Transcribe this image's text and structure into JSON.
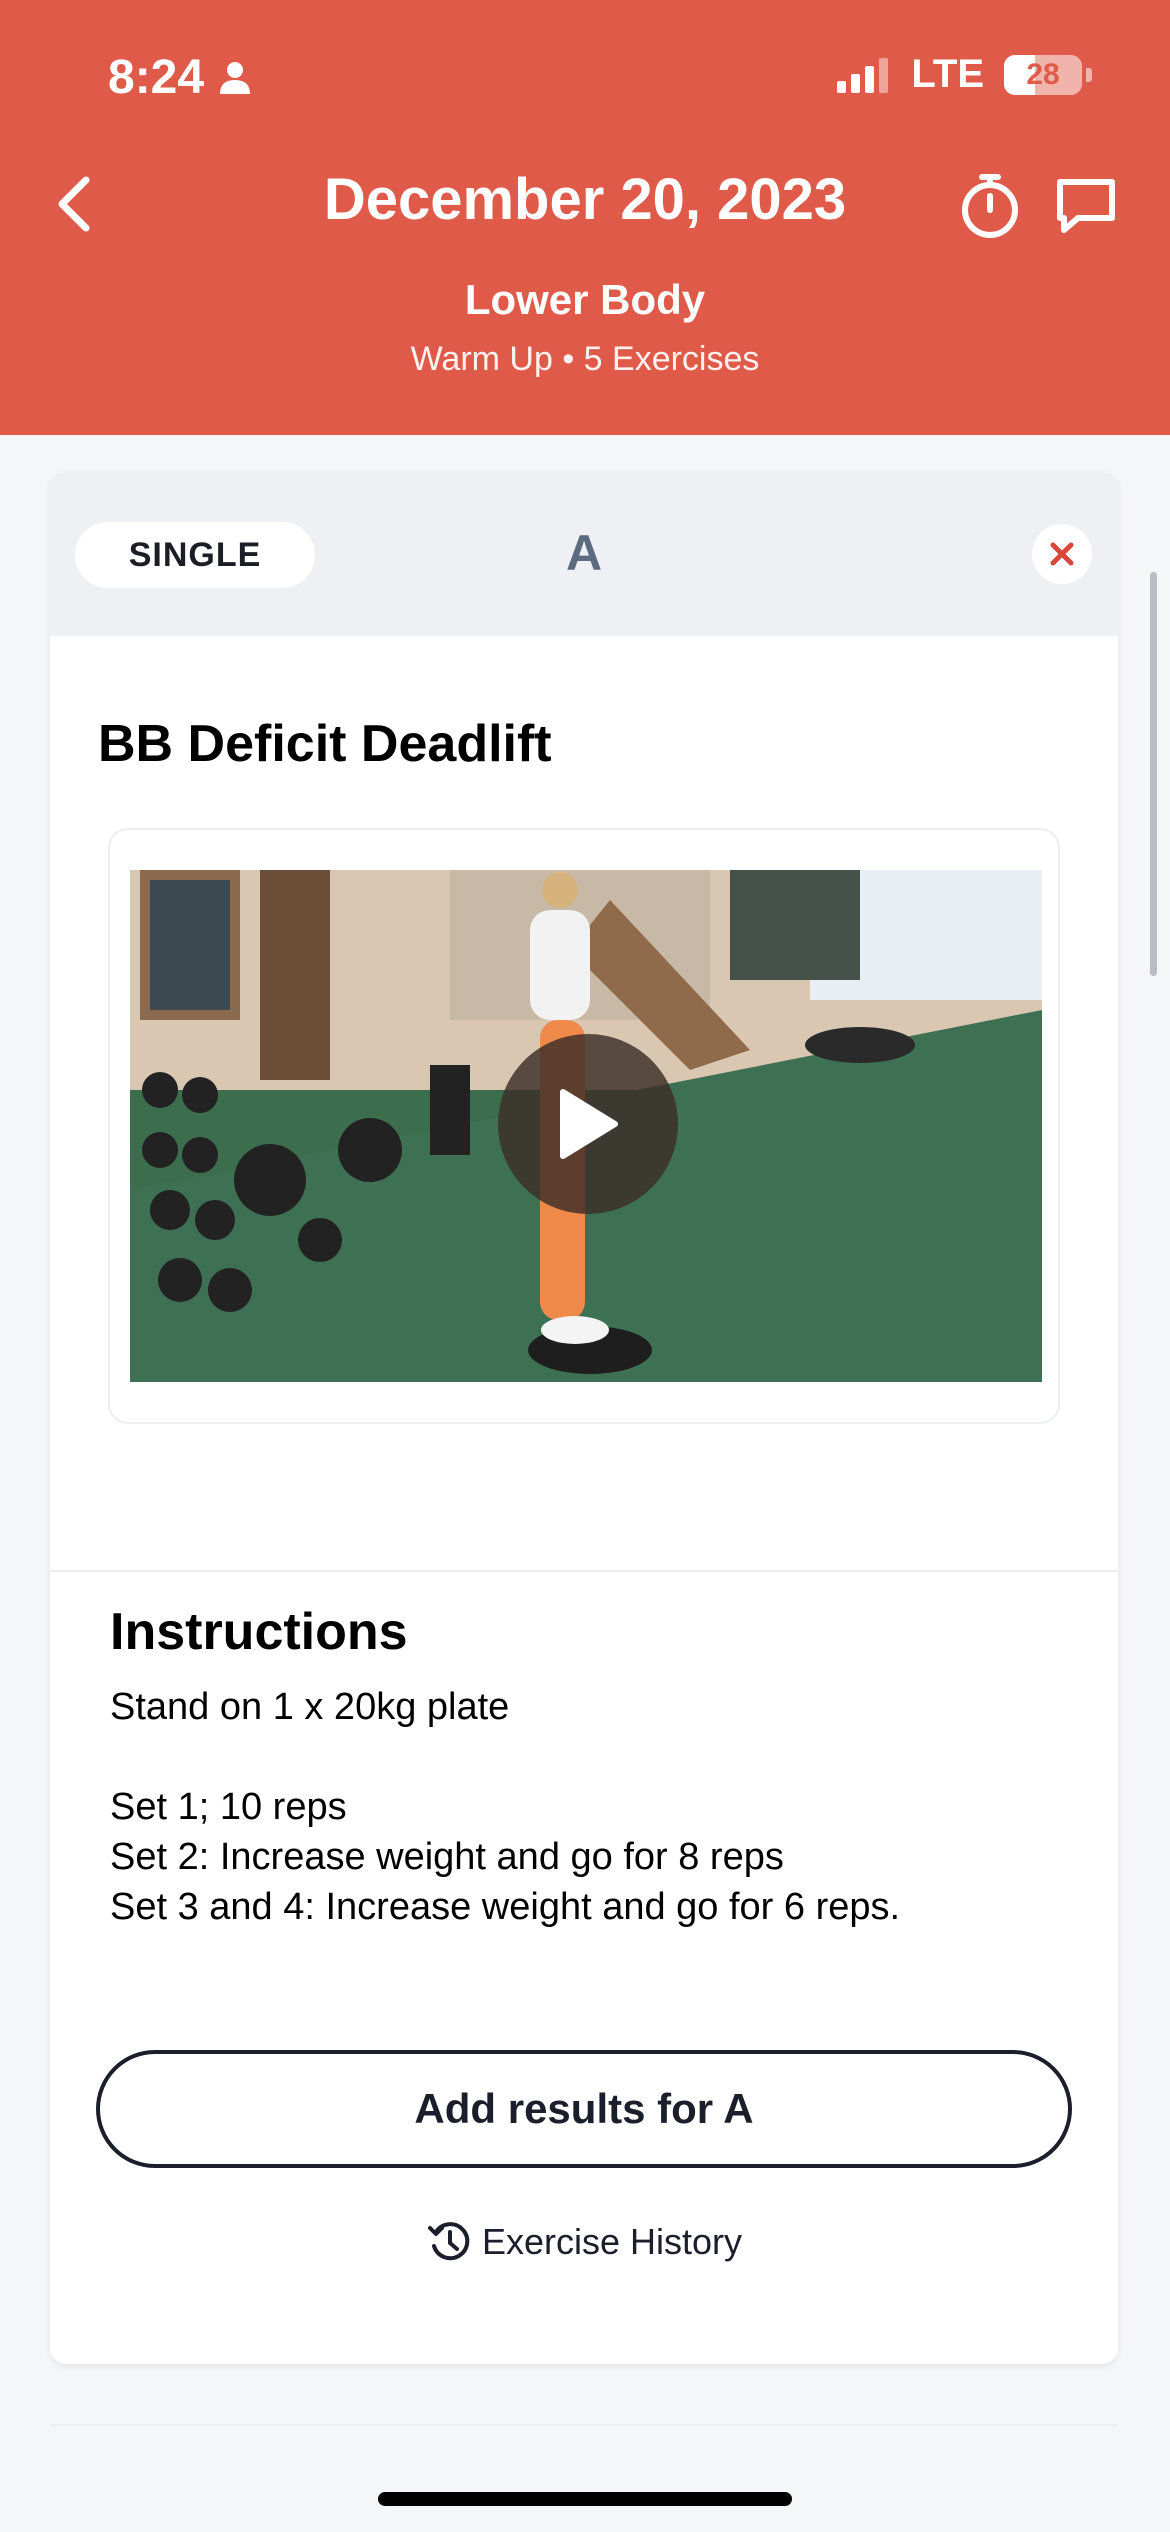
{
  "status_bar": {
    "time": "8:24",
    "network": "LTE",
    "battery": "28",
    "icons": [
      "person-icon",
      "signal-icon",
      "battery-icon"
    ]
  },
  "header": {
    "title": "December 20, 2023",
    "subtitle": "Lower Body",
    "meta": "Warm Up • 5 Exercises",
    "background": "#e05a49",
    "icons": [
      "back-chevron-icon",
      "stopwatch-icon",
      "chat-bubble-icon"
    ]
  },
  "card": {
    "type_pill": "SINGLE",
    "letter": "A",
    "exercise_name": "BB Deficit Deadlift",
    "video": {
      "icon": "play-icon"
    },
    "instructions": {
      "title": "Instructions",
      "lines": [
        "Stand on 1 x 20kg plate",
        "Set 1; 10 reps",
        "Set 2: Increase weight and go for 8 reps",
        "Set 3 and 4: Increase weight and go for 6 reps."
      ]
    },
    "add_results_label": "Add results for A",
    "history_label": "Exercise History",
    "close_color": "#d9463c"
  }
}
